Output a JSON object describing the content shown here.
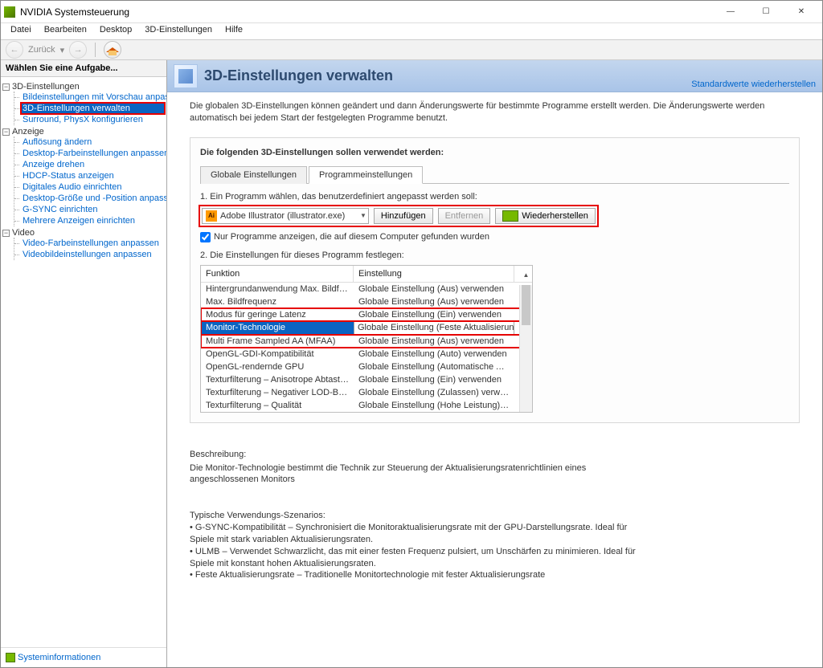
{
  "titlebar": {
    "title": "NVIDIA Systemsteuerung"
  },
  "menubar": [
    "Datei",
    "Bearbeiten",
    "Desktop",
    "3D-Einstellungen",
    "Hilfe"
  ],
  "navbar": {
    "back_label": "Zurück",
    "back_arrow": "←",
    "fwd_arrow": "→",
    "dropdown": "▾"
  },
  "sidebar": {
    "header": "Wählen Sie eine Aufgabe...",
    "groups": [
      {
        "label": "3D-Einstellungen",
        "items": [
          "Bildeinstellungen mit Vorschau anpassen",
          "3D-Einstellungen verwalten",
          "Surround, PhysX konfigurieren"
        ]
      },
      {
        "label": "Anzeige",
        "items": [
          "Auflösung ändern",
          "Desktop-Farbeinstellungen anpassen",
          "Anzeige drehen",
          "HDCP-Status anzeigen",
          "Digitales Audio einrichten",
          "Desktop-Größe und -Position anpassen",
          "G-SYNC einrichten",
          "Mehrere Anzeigen einrichten"
        ]
      },
      {
        "label": "Video",
        "items": [
          "Video-Farbeinstellungen anpassen",
          "Videobildeinstellungen anpassen"
        ]
      }
    ],
    "sysinfo": "Systeminformationen"
  },
  "page": {
    "title": "3D-Einstellungen verwalten",
    "restore": "Standardwerte wiederherstellen",
    "intro": "Die globalen 3D-Einstellungen können geändert und dann Änderungswerte für bestimmte Programme erstellt werden. Die Änderungswerte werden automatisch bei jedem Start der festgelegten Programme benutzt.",
    "panel_title": "Die folgenden 3D-Einstellungen sollen verwendet werden:",
    "tabs": {
      "global": "Globale Einstellungen",
      "program": "Programmeinstellungen"
    },
    "step1": {
      "label": "1. Ein Programm wählen, das benutzerdefiniert angepasst werden soll:",
      "program": "Adobe Illustrator (illustrator.exe)",
      "add": "Hinzufügen",
      "remove": "Entfernen",
      "restore": "Wiederherstellen",
      "ai_badge": "Ai"
    },
    "only_local": "Nur Programme anzeigen, die auf diesem Computer gefunden wurden",
    "step2": {
      "label": "2. Die Einstellungen für dieses Programm festlegen:",
      "col_function": "Funktion",
      "col_setting": "Einstellung",
      "rows": [
        {
          "f": "Hintergrundanwendung Max. Bildfrequenz",
          "s": "Globale Einstellung (Aus) verwenden"
        },
        {
          "f": "Max. Bildfrequenz",
          "s": "Globale Einstellung (Aus) verwenden"
        },
        {
          "f": "Modus für geringe Latenz",
          "s": "Globale Einstellung (Ein) verwenden"
        },
        {
          "f": "Monitor-Technologie",
          "s": "Globale Einstellung (Feste Aktualisierungsra"
        },
        {
          "f": "Multi Frame Sampled AA (MFAA)",
          "s": "Globale Einstellung (Aus) verwenden"
        },
        {
          "f": "OpenGL-GDI-Kompatibilität",
          "s": "Globale Einstellung (Auto) verwenden"
        },
        {
          "f": "OpenGL-rendernde GPU",
          "s": "Globale Einstellung (Automatische Auswahl..."
        },
        {
          "f": "Texturfilterung – Anisotrope Abtastoptimi...",
          "s": "Globale Einstellung (Ein) verwenden"
        },
        {
          "f": "Texturfilterung – Negativer LOD-Bias",
          "s": "Globale Einstellung (Zulassen) verwenden"
        },
        {
          "f": "Texturfilterung – Qualität",
          "s": "Globale Einstellung (Hohe Leistung) verwe..."
        }
      ],
      "selected_index": 3,
      "dropdown_arrow": "⌄"
    },
    "description": {
      "heading": "Beschreibung:",
      "text": "Die Monitor-Technologie bestimmt die Technik zur Steuerung der Aktualisierungsratenrichtlinien eines angeschlossenen Monitors"
    },
    "scenarios": {
      "heading": "Typische Verwendungs-Szenarios:",
      "items": [
        "G-SYNC-Kompatibilität – Synchronisiert die Monitoraktualisierungsrate mit der GPU-Darstellungsrate. Ideal für Spiele mit stark variablen Aktualisierungsraten.",
        "ULMB – Verwendet Schwarzlicht, das mit einer festen Frequenz pulsiert, um Unschärfen zu minimieren. Ideal für Spiele mit konstant hohen Aktualisierungsraten.",
        "Feste Aktualisierungsrate – Traditionelle Monitortechnologie mit fester Aktualisierungsrate"
      ]
    }
  }
}
